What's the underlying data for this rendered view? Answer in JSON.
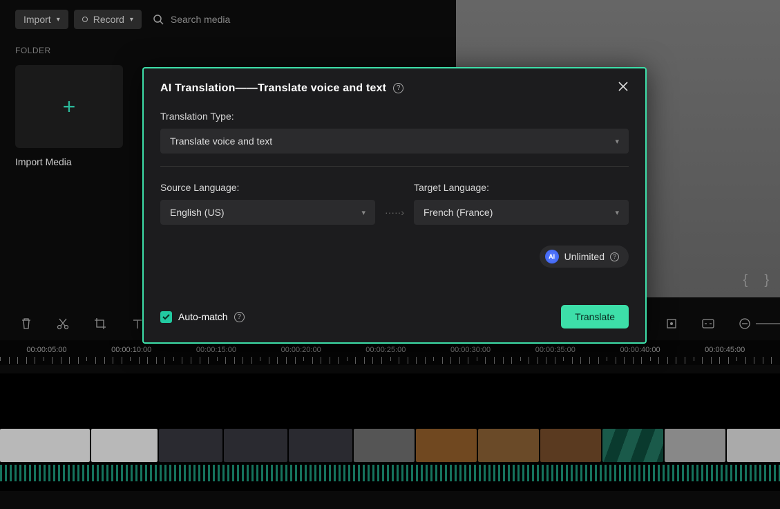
{
  "toolbar": {
    "import_label": "Import",
    "record_label": "Record",
    "search_placeholder": "Search media"
  },
  "media": {
    "folder_label": "FOLDER",
    "import_tile": "Import Media"
  },
  "timeline_labels": [
    "00:00:05:00",
    "00:00:10:00",
    "00:00:15:00",
    "00:00:20:00",
    "00:00:25:00",
    "00:00:30:00",
    "00:00:35:00",
    "00:00:40:00",
    "00:00:45:00"
  ],
  "modal": {
    "title": "AI Translation——Translate voice and text",
    "translation_type_label": "Translation Type:",
    "translation_type_value": "Translate voice and text",
    "source_label": "Source Language:",
    "source_value": "English (US)",
    "target_label": "Target Language:",
    "target_value": "French (France)",
    "unlimited_label": "Unlimited",
    "auto_match_label": "Auto-match",
    "translate_button": "Translate"
  },
  "braces": {
    "left": "{",
    "right": "}"
  }
}
